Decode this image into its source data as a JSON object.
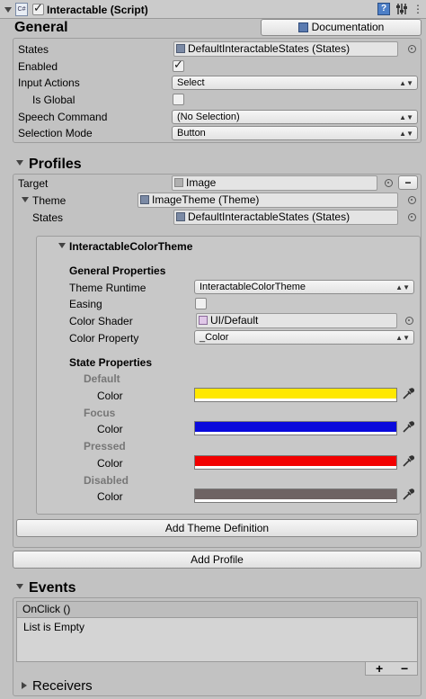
{
  "component": {
    "title": "Interactable (Script)",
    "enabled": true,
    "icons": [
      "script-icon",
      "help-icon",
      "preset-icon",
      "settings-icon"
    ]
  },
  "general": {
    "header": "General",
    "documentation_button": "Documentation",
    "rows": {
      "states_label": "States",
      "states_value": "DefaultInteractableStates (States)",
      "enabled_label": "Enabled",
      "enabled_checked": true,
      "input_actions_label": "Input Actions",
      "input_actions_value": "Select",
      "is_global_label": "Is Global",
      "is_global_checked": false,
      "speech_command_label": "Speech Command",
      "speech_command_value": "(No Selection)",
      "selection_mode_label": "Selection Mode",
      "selection_mode_value": "Button"
    }
  },
  "profiles": {
    "header": "Profiles",
    "target_label": "Target",
    "target_value": "Image",
    "remove_button": "−",
    "theme_label": "Theme",
    "theme_value": "ImageTheme (Theme)",
    "states_label": "States",
    "states_value": "DefaultInteractableStates (States)",
    "theme_box": {
      "title": "InteractableColorTheme",
      "general_properties": "General Properties",
      "theme_runtime_label": "Theme Runtime",
      "theme_runtime_value": "InteractableColorTheme",
      "easing_label": "Easing",
      "easing_checked": false,
      "color_shader_label": "Color Shader",
      "color_shader_value": "UI/Default",
      "color_property_label": "Color Property",
      "color_property_value": "_Color",
      "state_properties": "State Properties",
      "states": [
        {
          "name": "Default",
          "color_label": "Color",
          "color": "#ffe800"
        },
        {
          "name": "Focus",
          "color_label": "Color",
          "color": "#0a0adc"
        },
        {
          "name": "Pressed",
          "color_label": "Color",
          "color": "#f20000"
        },
        {
          "name": "Disabled",
          "color_label": "Color",
          "color": "#6e6363"
        }
      ],
      "add_theme_definition": "Add Theme Definition"
    },
    "add_profile": "Add Profile"
  },
  "events": {
    "header": "Events",
    "onclick_label": "OnClick ()",
    "list_empty": "List is Empty",
    "add_button": "+",
    "remove_button": "−",
    "receivers_label": "Receivers"
  }
}
